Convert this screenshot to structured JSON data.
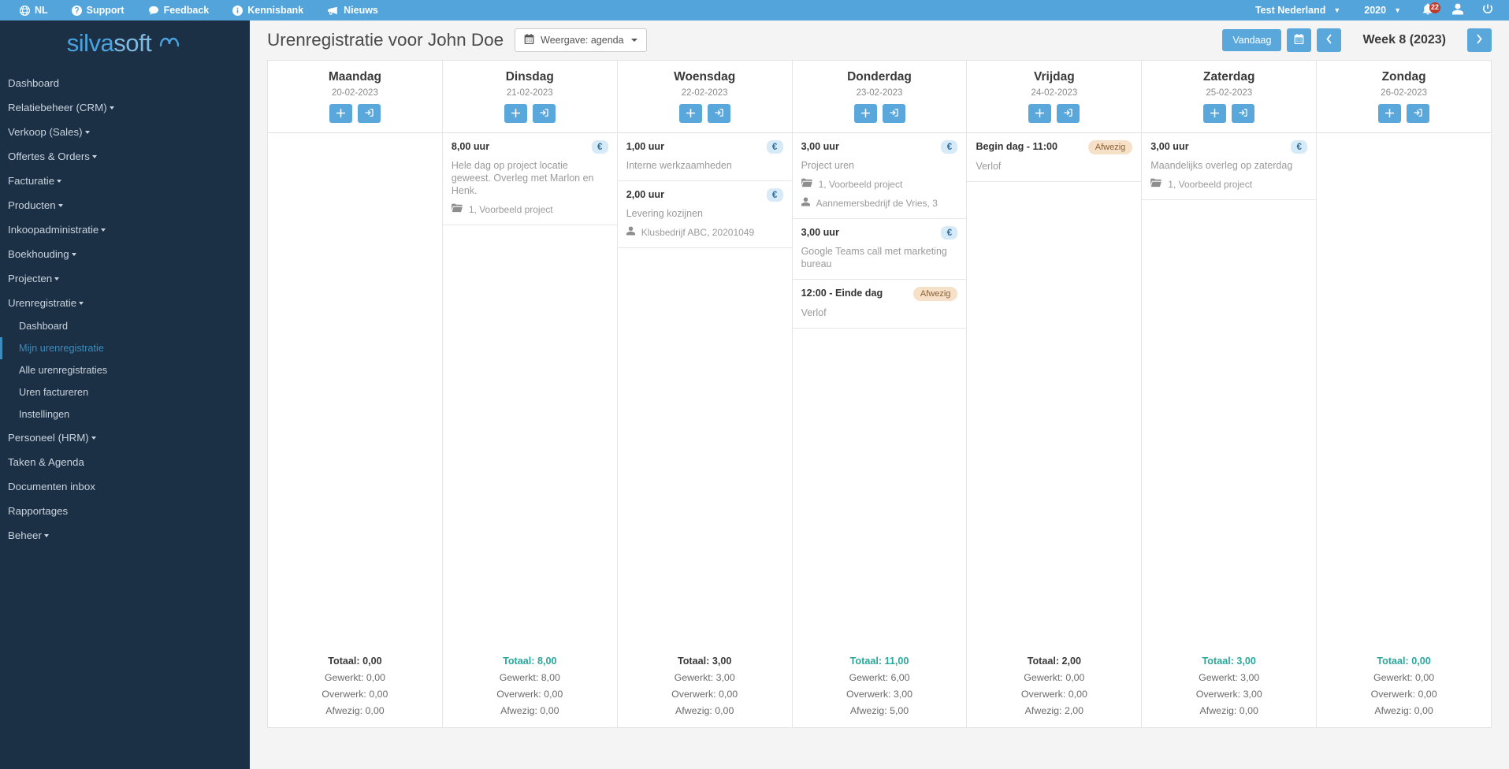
{
  "topbar": {
    "left_items": [
      {
        "label": "NL",
        "icon": "globe-icon"
      },
      {
        "label": "Support",
        "icon": "question-circle-icon"
      },
      {
        "label": "Feedback",
        "icon": "comment-icon"
      },
      {
        "label": "Kennisbank",
        "icon": "info-circle-icon"
      },
      {
        "label": "Nieuws",
        "icon": "bullhorn-icon"
      }
    ],
    "company": "Test Nederland",
    "year": "2020",
    "notification_count": "22",
    "accent": "#52a4db"
  },
  "sidebar": {
    "brand": {
      "part1": "silva",
      "part2": "soft"
    },
    "items": [
      {
        "label": "Dashboard",
        "caret": false,
        "level": "top"
      },
      {
        "label": "Relatiebeheer (CRM)",
        "caret": true,
        "level": "top"
      },
      {
        "label": "Verkoop (Sales)",
        "caret": true,
        "level": "top"
      },
      {
        "label": "Offertes & Orders",
        "caret": true,
        "level": "top"
      },
      {
        "label": "Facturatie",
        "caret": true,
        "level": "top"
      },
      {
        "label": "Producten",
        "caret": true,
        "level": "top"
      },
      {
        "label": "Inkoopadministratie",
        "caret": true,
        "level": "top"
      },
      {
        "label": "Boekhouding",
        "caret": true,
        "level": "top"
      },
      {
        "label": "Projecten",
        "caret": true,
        "level": "top"
      },
      {
        "label": "Urenregistratie",
        "caret": true,
        "level": "top"
      },
      {
        "label": "Dashboard",
        "caret": false,
        "level": "sub"
      },
      {
        "label": "Mijn urenregistratie",
        "caret": false,
        "level": "sub",
        "active": true
      },
      {
        "label": "Alle urenregistraties",
        "caret": false,
        "level": "sub"
      },
      {
        "label": "Uren factureren",
        "caret": false,
        "level": "sub"
      },
      {
        "label": "Instellingen",
        "caret": false,
        "level": "sub"
      },
      {
        "label": "Personeel (HRM)",
        "caret": true,
        "level": "top"
      },
      {
        "label": "Taken & Agenda",
        "caret": false,
        "level": "top"
      },
      {
        "label": "Documenten inbox",
        "caret": false,
        "level": "top"
      },
      {
        "label": "Rapportages",
        "caret": false,
        "level": "top"
      },
      {
        "label": "Beheer",
        "caret": true,
        "level": "top"
      }
    ],
    "active_color": "#3c8dbc"
  },
  "page": {
    "title": "Urenregistratie voor John Doe",
    "view_select_label": "Weergave: agenda",
    "today_button": "Vandaag",
    "week_label": "Week 8 (2023)"
  },
  "calendar": {
    "days": [
      {
        "name": "Maandag",
        "date": "20-02-2023",
        "entries": [],
        "totals": {
          "total": "Totaal: 0,00",
          "total_highlight": false,
          "worked": "Gewerkt: 0,00",
          "overtime": "Overwerk: 0,00",
          "absent": "Afwezig: 0,00"
        }
      },
      {
        "name": "Dinsdag",
        "date": "21-02-2023",
        "entries": [
          {
            "hours": "8,00 uur",
            "badge": "euro",
            "description": "Hele dag op project locatie geweest. Overleg met Marlon en Henk.",
            "meta": [
              {
                "icon": "folder-icon",
                "text": "1, Voorbeeld project"
              }
            ]
          }
        ],
        "totals": {
          "total": "Totaal: 8,00",
          "total_highlight": true,
          "worked": "Gewerkt: 8,00",
          "overtime": "Overwerk: 0,00",
          "absent": "Afwezig: 0,00"
        }
      },
      {
        "name": "Woensdag",
        "date": "22-02-2023",
        "entries": [
          {
            "hours": "1,00 uur",
            "badge": "euro",
            "description": "Interne werkzaamheden",
            "meta": []
          },
          {
            "hours": "2,00 uur",
            "badge": "euro",
            "description": "Levering kozijnen",
            "meta": [
              {
                "icon": "user-icon",
                "text": "Klusbedrijf ABC, 20201049"
              }
            ]
          }
        ],
        "totals": {
          "total": "Totaal: 3,00",
          "total_highlight": false,
          "worked": "Gewerkt: 3,00",
          "overtime": "Overwerk: 0,00",
          "absent": "Afwezig: 0,00"
        }
      },
      {
        "name": "Donderdag",
        "date": "23-02-2023",
        "entries": [
          {
            "hours": "3,00 uur",
            "badge": "euro",
            "description": "Project uren",
            "meta": [
              {
                "icon": "folder-icon",
                "text": "1, Voorbeeld project"
              },
              {
                "icon": "user-icon",
                "text": "Aannemersbedrijf de Vries, 3"
              }
            ]
          },
          {
            "hours": "3,00 uur",
            "badge": "euro",
            "description": "Google Teams call met marketing bureau",
            "meta": []
          },
          {
            "hours": "12:00 - Einde dag",
            "badge": "away",
            "badge_label": "Afwezig",
            "description": "Verlof",
            "meta": []
          }
        ],
        "totals": {
          "total": "Totaal: 11,00",
          "total_highlight": true,
          "worked": "Gewerkt: 6,00",
          "overtime": "Overwerk: 3,00",
          "absent": "Afwezig: 5,00"
        }
      },
      {
        "name": "Vrijdag",
        "date": "24-02-2023",
        "entries": [
          {
            "hours": "Begin dag - 11:00",
            "badge": "away",
            "badge_label": "Afwezig",
            "description": "Verlof",
            "meta": []
          }
        ],
        "totals": {
          "total": "Totaal: 2,00",
          "total_highlight": false,
          "worked": "Gewerkt: 0,00",
          "overtime": "Overwerk: 0,00",
          "absent": "Afwezig: 2,00"
        }
      },
      {
        "name": "Zaterdag",
        "date": "25-02-2023",
        "entries": [
          {
            "hours": "3,00 uur",
            "badge": "euro",
            "description": "Maandelijks overleg op zaterdag",
            "meta": [
              {
                "icon": "folder-icon",
                "text": "1, Voorbeeld project"
              }
            ]
          }
        ],
        "totals": {
          "total": "Totaal: 3,00",
          "total_highlight": true,
          "worked": "Gewerkt: 3,00",
          "overtime": "Overwerk: 3,00",
          "absent": "Afwezig: 0,00"
        }
      },
      {
        "name": "Zondag",
        "date": "26-02-2023",
        "entries": [],
        "totals": {
          "total": "Totaal: 0,00",
          "total_highlight": true,
          "worked": "Gewerkt: 0,00",
          "overtime": "Overwerk: 0,00",
          "absent": "Afwezig: 0,00"
        }
      }
    ],
    "day_buttons": [
      {
        "icon": "plus-icon",
        "name": "add-hours-button"
      },
      {
        "icon": "sign-out-icon",
        "name": "register-day-button"
      }
    ],
    "euro_badge_symbol": "€",
    "highlight_color": "#2aa79b"
  }
}
